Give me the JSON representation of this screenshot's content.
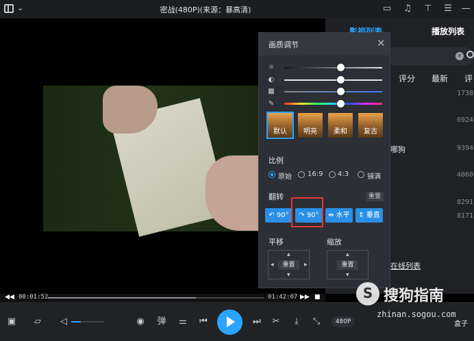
{
  "titlebar": {
    "title": "密战(480P)(来源：暴高清)"
  },
  "playlist": {
    "tab_active": "影视列表",
    "tab_other": "播放列表",
    "sort_options": [
      "评分",
      "最新",
      "评"
    ],
    "numbers": [
      "1738",
      "6924",
      "9394",
      "4060",
      "8291",
      "8171"
    ],
    "fragment_text": "哪狗",
    "online_list": "在线列表"
  },
  "popup": {
    "title": "画质调节",
    "sliders": [
      {
        "name": "brightness",
        "icon": "sun-icon",
        "value": 0.5
      },
      {
        "name": "contrast",
        "icon": "contrast-icon",
        "value": 0.5
      },
      {
        "name": "saturation",
        "icon": "saturation-icon",
        "value": 0.5
      },
      {
        "name": "hue",
        "icon": "eyedropper-icon",
        "value": 0.5
      }
    ],
    "presets": [
      "默认",
      "明亮",
      "柔和",
      "复古"
    ],
    "ratio_label": "比例",
    "ratio_options": [
      "原始",
      "16:9",
      "4:3",
      "铺满"
    ],
    "flip_label": "翻转",
    "reset_label": "重置",
    "flip_buttons": [
      "90°",
      "90°",
      "水平",
      "垂直"
    ],
    "pan_label": "平移",
    "zoom_label": "缩放",
    "pad_reset": "重置"
  },
  "player": {
    "current_time": "00:01:52",
    "total_time": "01:42:07",
    "progress": 0.02,
    "volume": 0.3,
    "quality": "480P",
    "danmaku": "弹",
    "box_label": "盒子"
  },
  "watermark": {
    "main": "搜狗指南",
    "sub": "zhinan.sogou.com"
  }
}
